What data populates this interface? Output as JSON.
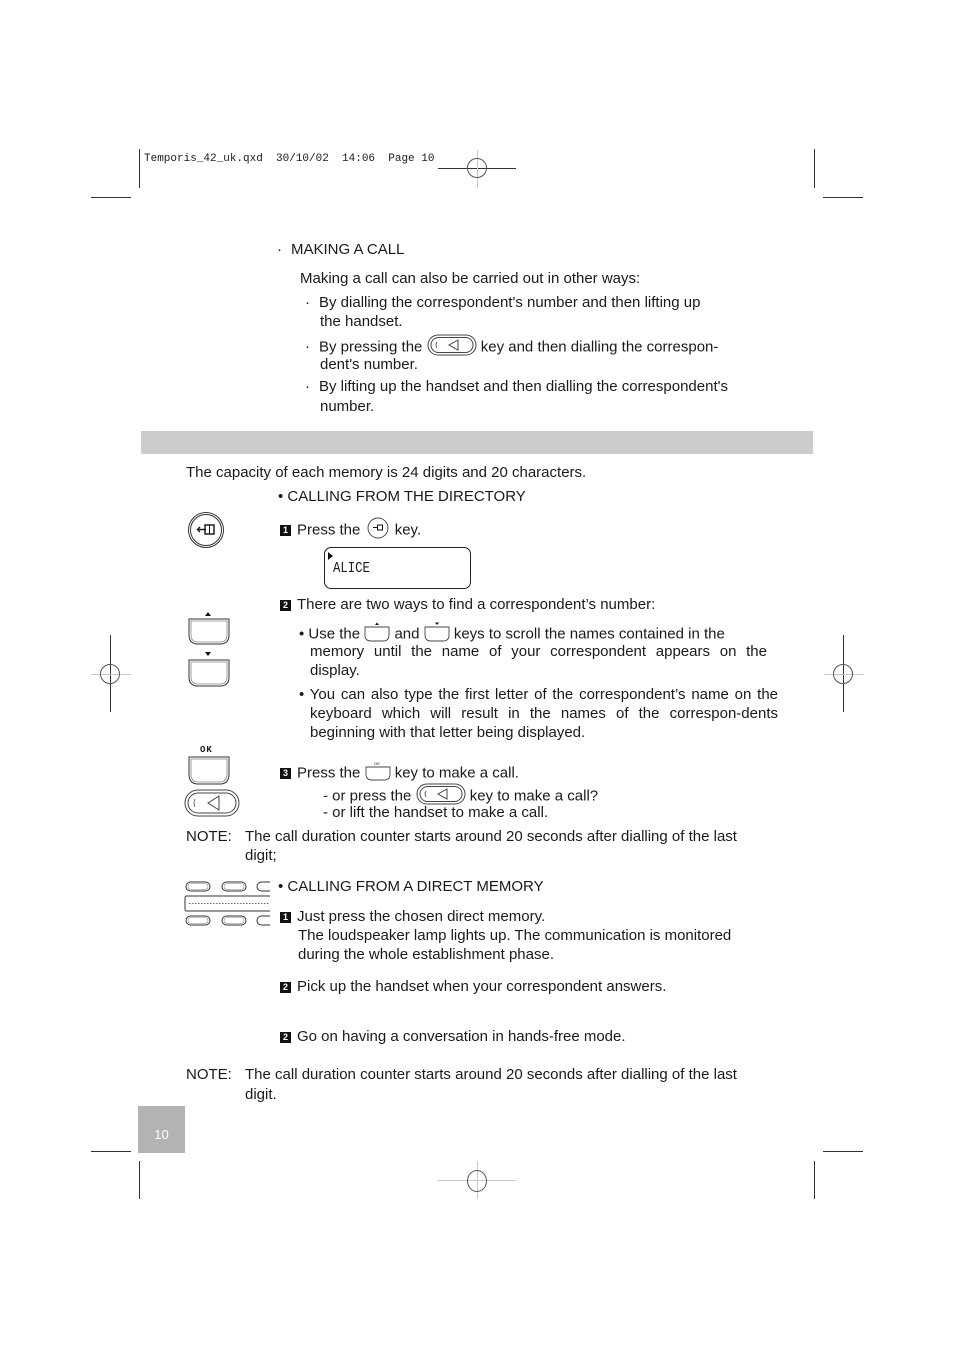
{
  "print_header": {
    "slug": "Temporis_42_uk.qxd  30/10/02  14:06  Page 10"
  },
  "making_a_call": {
    "heading": "MAKING A CALL",
    "intro": "Making a call can also be carried out in other ways:",
    "items": [
      {
        "line1": "By dialling the correspondent's number and then lifting up",
        "line2": "the handset."
      },
      {
        "before_key": "By pressing the",
        "after_key": "key and then dialling the correspon-",
        "line2": "dent's number."
      },
      {
        "line1": "By lifting up the handset and then dialling the correspondent's",
        "line2": "number."
      }
    ]
  },
  "memory_capacity": "The capacity of each memory is 24 digits and 20 characters.",
  "directory": {
    "heading": "• CALLING FROM THE DIRECTORY",
    "step1": {
      "num": "1",
      "before_key": "Press the",
      "after_key": "key."
    },
    "display_text": "ALICE",
    "step2": {
      "num": "2",
      "text": "There are two ways to find a correspondent’s number:",
      "bullet1": {
        "before": "• Use the",
        "mid": "and",
        "after": "keys to scroll the names contained in the",
        "rest": "memory until the name of your correspondent appears on the display."
      },
      "bullet2": "• You can also type the first letter of the correspondent’s name on the keyboard which will result in the names of the correspon-dents beginning with that letter being displayed."
    },
    "step3": {
      "num": "3",
      "before_key": "Press the",
      "after_key": "key to make a call.",
      "alt1_before": "- or press the",
      "alt1_after": "key to make a call?",
      "alt2": "- or lift the handset to make a call."
    },
    "ok_label": "OK",
    "note_label": "NOTE:",
    "note_line1": "The call duration counter starts around 20 seconds after dialling of the last",
    "note_line2": "digit;"
  },
  "direct_memory": {
    "heading": "• CALLING FROM A DIRECT MEMORY",
    "step1": {
      "num": "1",
      "line1": "Just press the chosen direct memory.",
      "line2": "The loudspeaker lamp lights up. The communication is monitored",
      "line3": "during the whole establishment phase."
    },
    "step2": {
      "num": "2",
      "text": "Pick up the handset when your correspondent answers."
    },
    "step3": {
      "num": "2",
      "text": "Go on having a conversation in hands-free mode."
    },
    "note_label": "NOTE:",
    "note_line1": "The call duration counter starts around 20 seconds after dialling of the last",
    "note_line2": "digit."
  },
  "page_number": "10",
  "icons": {
    "directory_key": "directory-key-icon",
    "speaker_key": "speaker-key-icon",
    "up_key": "up-arrow-key-icon",
    "down_key": "down-arrow-key-icon",
    "ok_key": "ok-key-icon",
    "direct_memory_keys": "direct-memory-keys-icon"
  }
}
